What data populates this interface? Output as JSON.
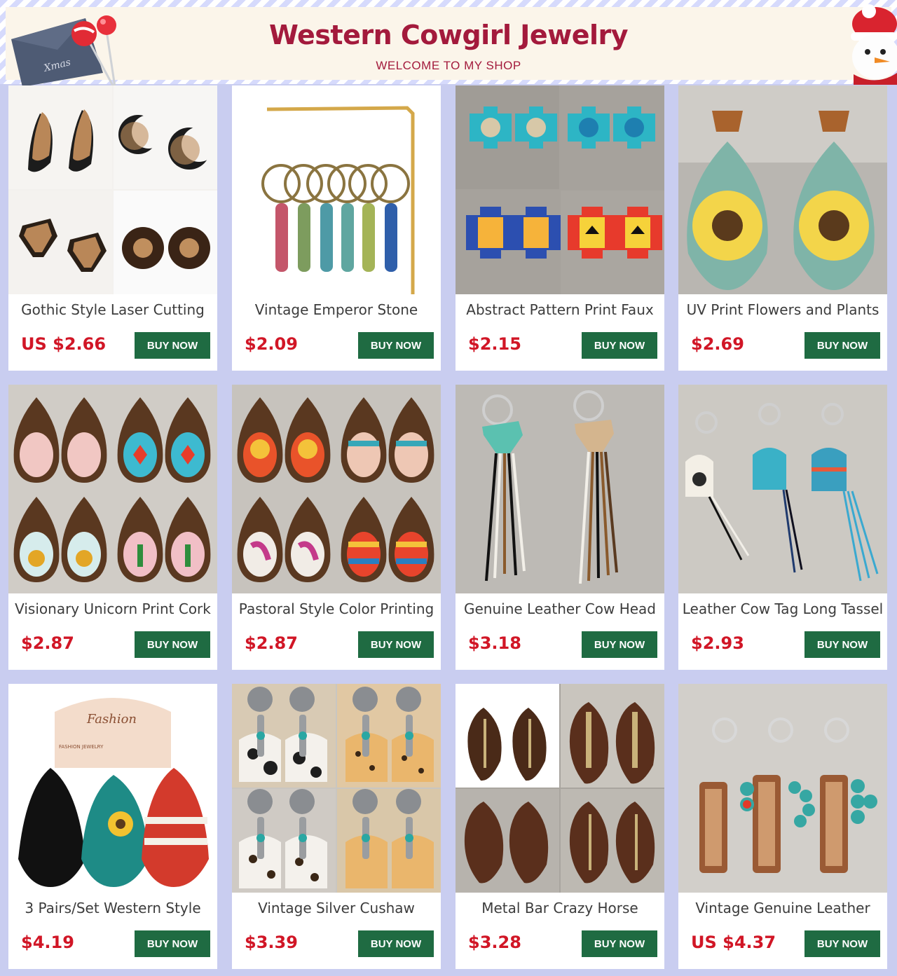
{
  "banner": {
    "title": "Western Cowgirl Jewelry",
    "subtitle": "WELCOME TO MY SHOP",
    "envelope_text": "Xmas"
  },
  "buy_label": "BUY NOW",
  "products": [
    {
      "title": "Gothic Style Laser Cutting",
      "price": "US $2.66",
      "image": "laser-cut-earrings"
    },
    {
      "title": "Vintage Emperor Stone",
      "price": "$2.09",
      "image": "stone-bead-hoops"
    },
    {
      "title": "Abstract Pattern Print Faux",
      "price": "$2.15",
      "image": "aztec-cross-earrings"
    },
    {
      "title": "UV Print Flowers and Plants",
      "price": "$2.69",
      "image": "sunflower-teardrops"
    },
    {
      "title": "Visionary Unicorn Print Cork",
      "price": "$2.87",
      "image": "cork-teardrop-earrings"
    },
    {
      "title": "Pastoral Style Color Printing",
      "price": "$2.87",
      "image": "sunset-teardrop-earrings"
    },
    {
      "title": "Genuine Leather Cow Head",
      "price": "$3.18",
      "image": "cow-head-tassel-keychains"
    },
    {
      "title": "Leather Cow Tag Long Tassel",
      "price": "$2.93",
      "image": "cow-tag-tassel-keychains"
    },
    {
      "title": "3 Pairs/Set Western Style",
      "price": "$4.19",
      "image": "fashion-card-earring-set"
    },
    {
      "title": "Vintage Silver Cushaw",
      "price": "$3.39",
      "image": "concho-cactus-earrings"
    },
    {
      "title": "Metal Bar Crazy Horse",
      "price": "$3.28",
      "image": "leather-leaf-earrings"
    },
    {
      "title": "Vintage Genuine Leather",
      "price": "US $4.37",
      "image": "tooled-leather-keychains"
    }
  ],
  "card_overlay_text": {
    "fashion_card": "Fashion",
    "fashion_tag": "FASHION JEWELRY"
  },
  "colors": {
    "page_bg": "#c9cdf0",
    "title": "#a31a3c",
    "price": "#d11626",
    "button": "#1f6b42"
  }
}
